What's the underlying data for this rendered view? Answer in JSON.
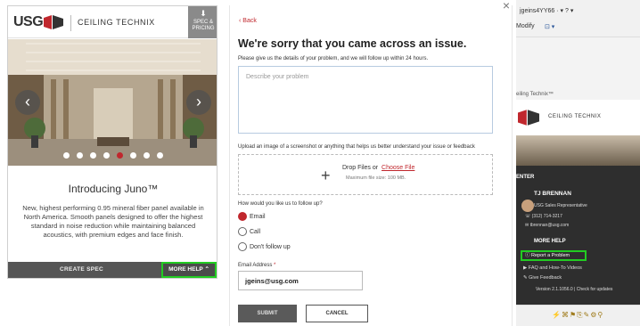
{
  "left_app": {
    "logo": "USG",
    "brand": "CEILING TECHNIX",
    "spec_button": [
      "SPEC &",
      "PRICING"
    ],
    "carousel": {
      "dots": 8,
      "active_dot": 4
    },
    "title": "Introducing Juno™",
    "description": "New, highest performing 0.95 mineral fiber panel available in North America. Smooth panels designed to offer the highest standard in noise reduction while maintaining balanced acoustics, with premium edges and face finish.",
    "create_spec_label": "CREATE SPEC",
    "more_help_label": "MORE HELP ⌃"
  },
  "report_form": {
    "back_label": "‹ Back",
    "close": "×",
    "heading": "We're sorry that you came across an issue.",
    "subheading": "Please give us the details of your problem, and we will follow up within 24 hours.",
    "textarea_placeholder": "Describe your problem",
    "upload_label": "Upload an image of a screenshot or anything that helps us better understand your issue or feedback",
    "drop_text": "Drop Files or",
    "choose_file": "Choose File",
    "max_size": "Maximum file size: 100 MB.",
    "follow_label": "How would you like us to follow up?",
    "options": [
      {
        "label": "Email",
        "selected": true
      },
      {
        "label": "Call",
        "selected": false
      },
      {
        "label": "Don't follow up",
        "selected": false
      }
    ],
    "email_label": "Email Address",
    "email_required": "*",
    "email_value": "jgeins@usg.com",
    "submit_label": "SUBMIT",
    "cancel_label": "CANCEL"
  },
  "excel_pane": {
    "user": "jgeins4YY66 · ▾  ?  ▾",
    "modify": "Modify",
    "ribbon_item": "⊡ ▾",
    "pane_title": "eiling Technix™",
    "brand": "CEILING TECHNIX",
    "center_label": "ENTER",
    "rep_name": "TJ BRENNAN",
    "rep_role": "USG Sales Representative",
    "phone": "(312) 714-3217",
    "email": "tbrennan@usg.com",
    "more_help": "MORE HELP",
    "report_problem": "Report a Problem",
    "faq": "FAQ and How-To Videos",
    "feedback": "Give Feedback",
    "version": "Version 2.1.1056.0 | Check for updates",
    "tray_icons": "⚡⌘⚑⎘✎⚙⚲"
  },
  "colors": {
    "usg_red": "#c0272d",
    "highlight_green": "#22cc22",
    "dark_pane": "#2e2e2e"
  }
}
